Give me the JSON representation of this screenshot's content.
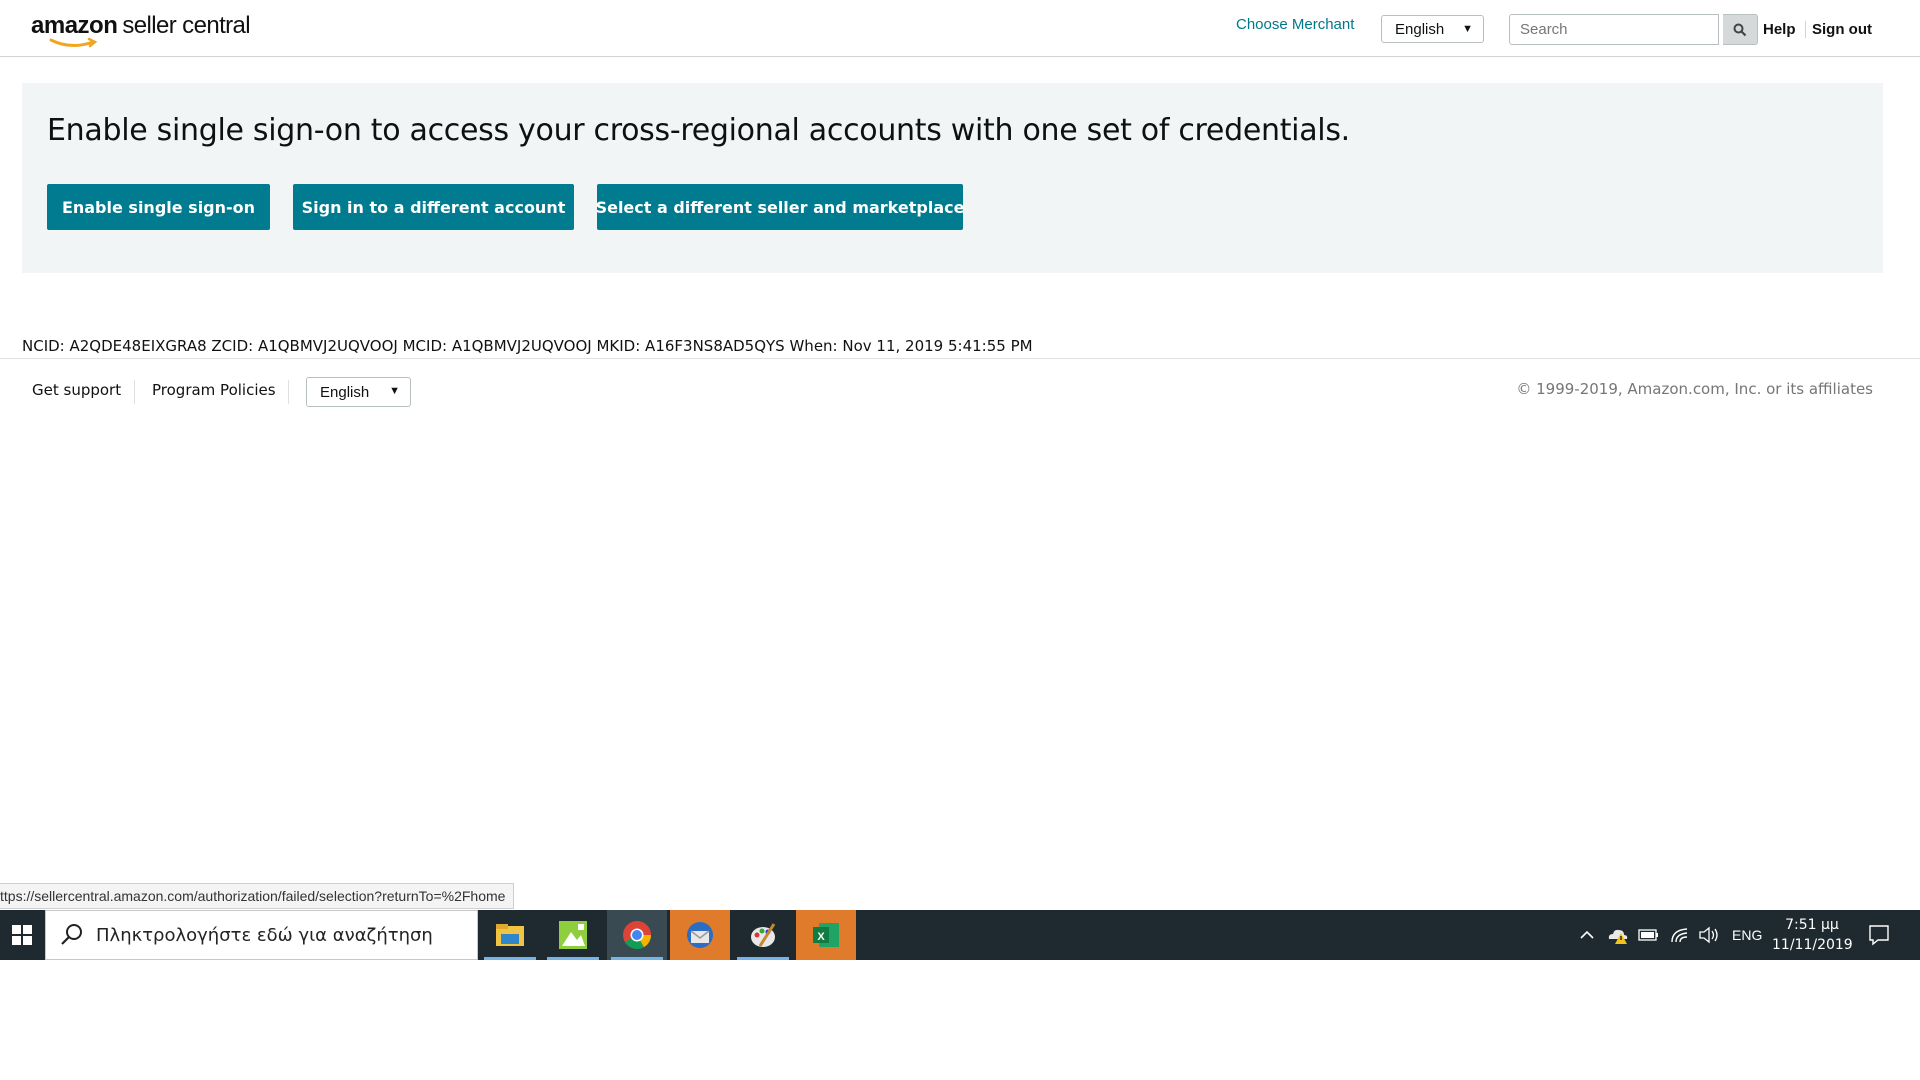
{
  "header": {
    "logo_amazon": "amazon",
    "logo_rest": "seller central",
    "choose_merchant": "Choose Merchant",
    "language": "English",
    "search_placeholder": "Search",
    "help": "Help",
    "sign_out": "Sign out"
  },
  "banner": {
    "title": "Enable single sign-on to access your cross-regional accounts with one set of credentials.",
    "buttons": [
      "Enable single sign-on",
      "Sign in to a different account",
      "Select a different seller and marketplace"
    ]
  },
  "ids_line": "NCID: A2QDE48EIXGRA8 ZCID: A1QBMVJ2UQVOOJ MCID: A1QBMVJ2UQVOOJ MKID: A16F3NS8AD5QYS When: Nov 11, 2019 5:41:55 PM",
  "footer": {
    "links": [
      "Get support",
      "Program Policies"
    ],
    "language": "English",
    "copyright": "© 1999-2019, Amazon.com, Inc. or its affiliates"
  },
  "status_url": "ttps://sellercentral.amazon.com/authorization/failed/selection?returnTo=%2Fhome",
  "taskbar": {
    "search_text": "Πληκτρολογήστε εδώ για αναζήτηση",
    "apps": [
      "file-explorer-icon",
      "photo-app-icon",
      "chrome-icon",
      "thunderbird-icon",
      "paint-icon",
      "excel-icon"
    ],
    "lang": "ENG",
    "time": "7:51 μμ",
    "date": "11/11/2019"
  },
  "colors": {
    "accent": "#007b8f",
    "link": "#00788a",
    "taskbar": "#1e2a30"
  }
}
